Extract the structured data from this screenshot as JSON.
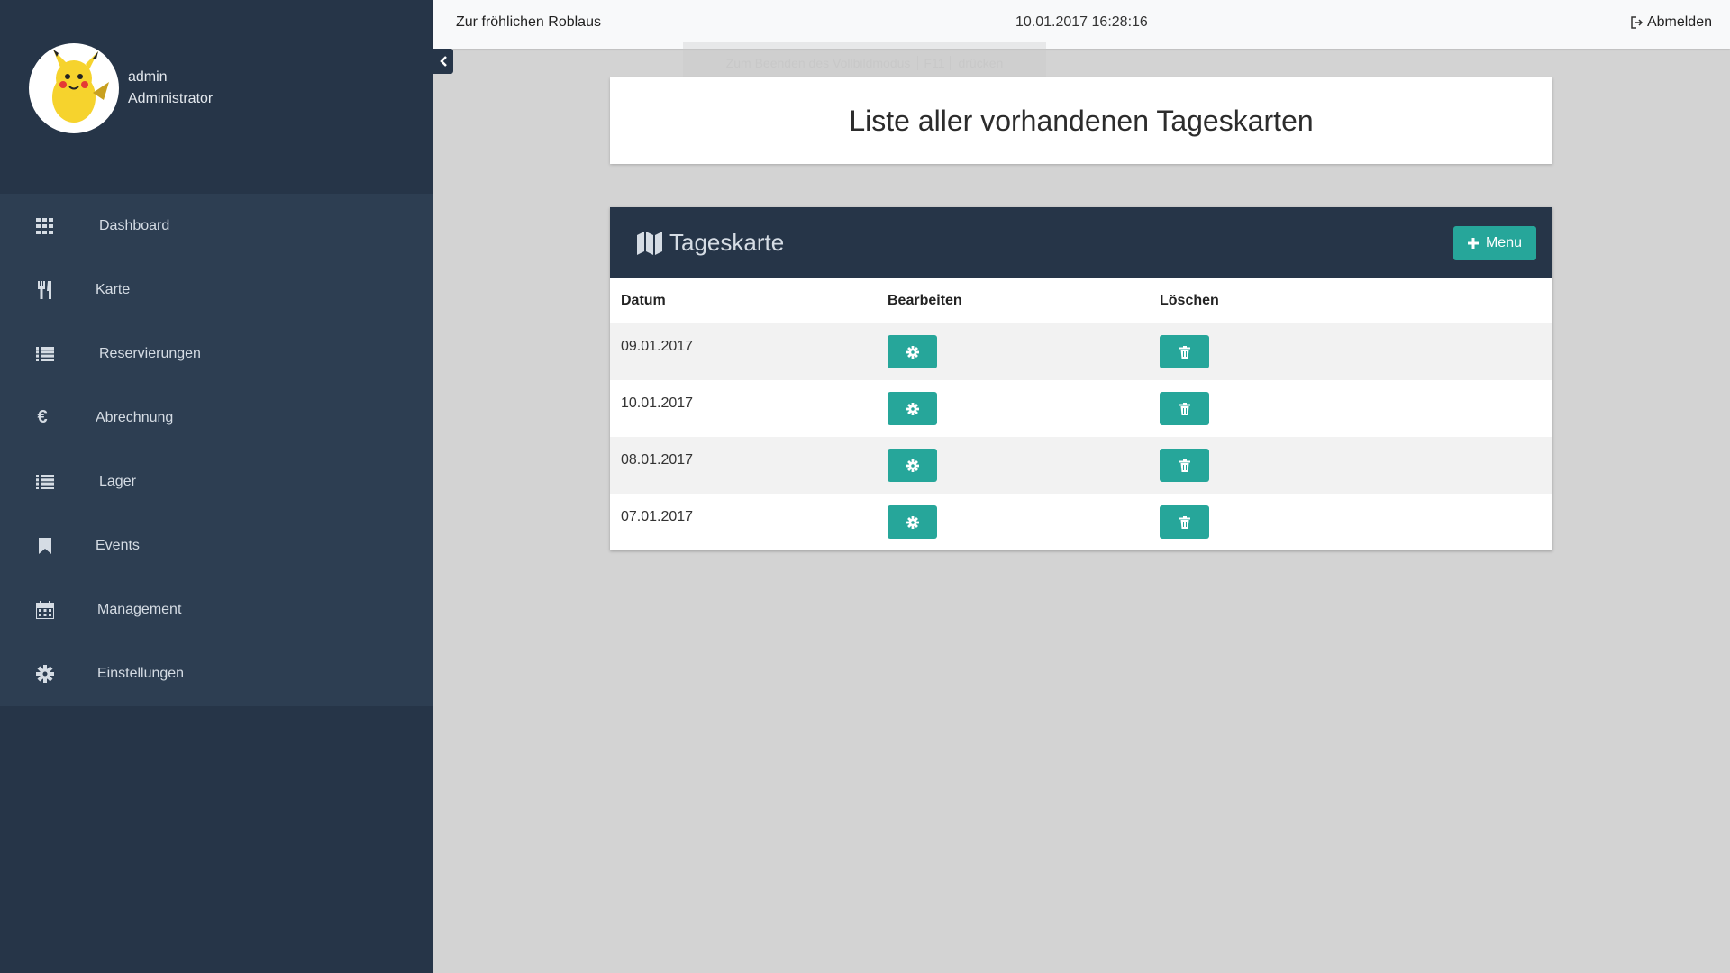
{
  "profile": {
    "username": "admin",
    "role": "Administrator"
  },
  "sidebar": {
    "items": [
      {
        "label": "Dashboard",
        "icon": "grid-icon"
      },
      {
        "label": "Karte",
        "icon": "cutlery-icon"
      },
      {
        "label": "Reservierungen",
        "icon": "list-icon"
      },
      {
        "label": "Abrechnung",
        "icon": "euro-icon"
      },
      {
        "label": "Lager",
        "icon": "list-icon"
      },
      {
        "label": "Events",
        "icon": "bookmark-icon"
      },
      {
        "label": "Management",
        "icon": "calendar-icon"
      },
      {
        "label": "Einstellungen",
        "icon": "gear-icon"
      }
    ]
  },
  "topbar": {
    "brand": "Zur fröhlichen Roblaus",
    "datetime": "10.01.2017 16:28:16",
    "logout_label": "Abmelden"
  },
  "fullscreen_hint": {
    "before": "Zum Beenden des Vollbildmodus",
    "key": "F11",
    "after": "drücken"
  },
  "page": {
    "title": "Liste aller vorhandenen Tageskarten"
  },
  "panel": {
    "title": "Tageskarte",
    "add_button_label": "Menu",
    "columns": {
      "date": "Datum",
      "edit": "Bearbeiten",
      "delete": "Löschen"
    },
    "rows": [
      {
        "date": "09.01.2017"
      },
      {
        "date": "10.01.2017"
      },
      {
        "date": "08.01.2017"
      },
      {
        "date": "07.01.2017"
      }
    ]
  },
  "colors": {
    "sidebar_bg": "#263548",
    "nav_bg": "#2d3e52",
    "accent": "#26a69a",
    "content_bg": "#d3d3d3"
  }
}
